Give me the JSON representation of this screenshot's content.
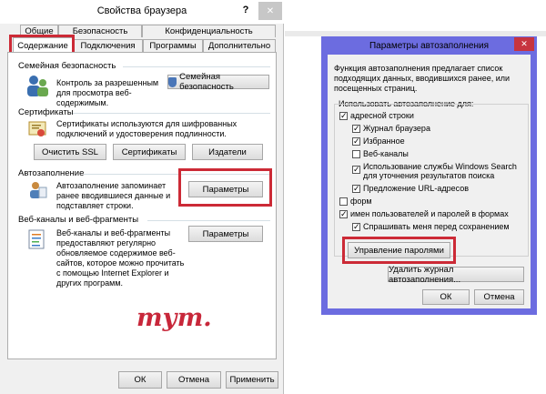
{
  "left_dialog": {
    "title": "Свойства браузера",
    "help": "?",
    "close": "✕",
    "tabs_row1": [
      "Общие",
      "Безопасность",
      "Конфиденциальность"
    ],
    "tabs_row2": [
      "Содержание",
      "Подключения",
      "Программы",
      "Дополнительно"
    ],
    "family_safety": {
      "heading": "Семейная безопасность",
      "desc": "Контроль за разрешенным для просмотра веб-содержимым.",
      "button": "Семейная безопасность"
    },
    "certificates": {
      "heading": "Сертификаты",
      "desc": "Сертификаты используются для шифрованных подключений и удостоверения подлинности.",
      "clear_ssl": "Очистить SSL",
      "certs": "Сертификаты",
      "publishers": "Издатели"
    },
    "autocomplete": {
      "heading": "Автозаполнение",
      "desc": "Автозаполнение запоминает ранее вводившиеся данные и подставляет строки.",
      "button": "Параметры"
    },
    "feeds": {
      "heading": "Веб-каналы и веб-фрагменты",
      "desc": "Веб-каналы и веб-фрагменты предоставляют регулярно обновляемое содержимое веб-сайтов, которое можно прочитать с помощью Internet Explorer и других программ.",
      "button": "Параметры"
    },
    "overlay_text": "тут.",
    "ok": "ОК",
    "cancel": "Отмена",
    "apply": "Применить"
  },
  "right_dialog": {
    "title": "Параметры автозаполнения",
    "close": "✕",
    "intro": "Функция автозаполнения предлагает список подходящих данных, вводившихся ранее, или посещенных страниц.",
    "use_for": "Использовать автозаполнение для:",
    "options": [
      {
        "label": "адресной строки",
        "checked": true
      },
      {
        "label": "Журнал браузера",
        "checked": true
      },
      {
        "label": "Избранное",
        "checked": true
      },
      {
        "label": "Веб-каналы",
        "checked": false
      },
      {
        "label": "Использование службы Windows Search для уточнения результатов поиска",
        "checked": true
      },
      {
        "label": "Предложение URL-адресов",
        "checked": true
      },
      {
        "label": "форм",
        "checked": false
      },
      {
        "label": "имен пользователей и паролей в формах",
        "checked": true
      },
      {
        "label": "Спрашивать меня перед сохранением паролей",
        "checked": true
      }
    ],
    "manage_passwords": "Управление паролями",
    "delete_history": "Удалить журнал автозаполнения...",
    "ok": "ОК",
    "cancel": "Отмена"
  },
  "colors": {
    "accent_red": "#cc2a36",
    "dialog_title_blue": "#6c6ce0",
    "overlay_text": "#c8273a"
  }
}
